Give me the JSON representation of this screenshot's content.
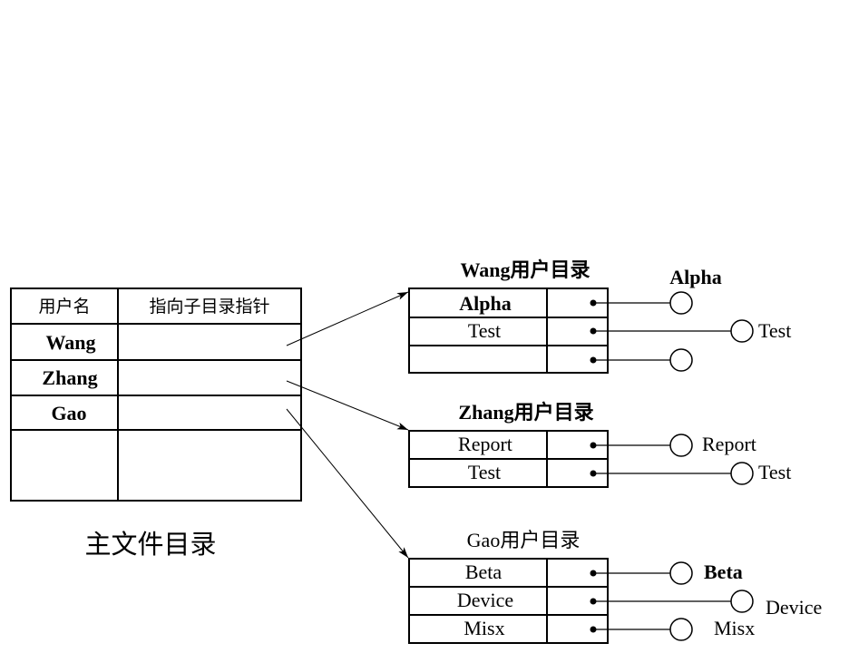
{
  "master_directory": {
    "caption": "主文件目录",
    "headers": [
      "用户名",
      "指向子目录指针"
    ],
    "rows": [
      {
        "user": "Wang",
        "pointer": ""
      },
      {
        "user": "Zhang",
        "pointer": ""
      },
      {
        "user": "Gao",
        "pointer": ""
      },
      {
        "user": "",
        "pointer": ""
      }
    ]
  },
  "user_directories": [
    {
      "owner": "Wang",
      "title": "Wang用户目录",
      "entries": [
        {
          "name": "Alpha",
          "file_label": "Alpha"
        },
        {
          "name": "Test",
          "file_label": "Test"
        },
        {
          "name": "",
          "file_label": ""
        }
      ]
    },
    {
      "owner": "Zhang",
      "title": "Zhang用户目录",
      "entries": [
        {
          "name": "Report",
          "file_label": "Report"
        },
        {
          "name": "Test",
          "file_label": "Test"
        }
      ]
    },
    {
      "owner": "Gao",
      "title": "Gao用户目录",
      "entries": [
        {
          "name": "Beta",
          "file_label": "Beta"
        },
        {
          "name": "Device",
          "file_label": "Device"
        },
        {
          "name": "Misx",
          "file_label": "Misx"
        }
      ]
    }
  ],
  "colors": {
    "stroke": "#000000",
    "background": "#ffffff"
  }
}
